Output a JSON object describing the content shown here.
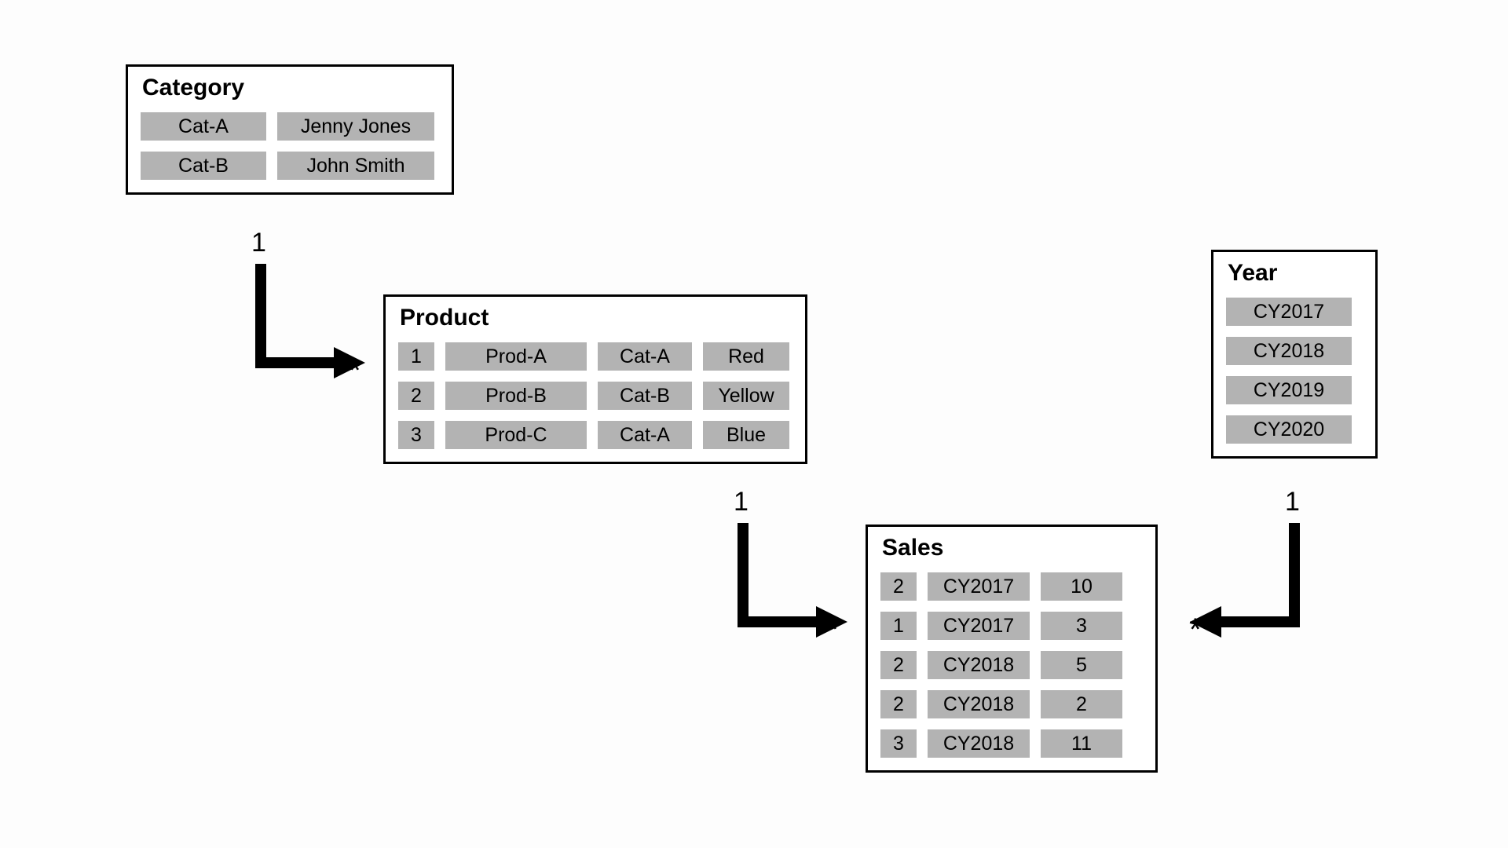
{
  "entities": {
    "category": {
      "title": "Category",
      "rows": [
        [
          "Cat-A",
          "Jenny Jones"
        ],
        [
          "Cat-B",
          "John Smith"
        ]
      ]
    },
    "product": {
      "title": "Product",
      "rows": [
        [
          "1",
          "Prod-A",
          "Cat-A",
          "Red"
        ],
        [
          "2",
          "Prod-B",
          "Cat-B",
          "Yellow"
        ],
        [
          "3",
          "Prod-C",
          "Cat-A",
          "Blue"
        ]
      ]
    },
    "year": {
      "title": "Year",
      "rows": [
        [
          "CY2017"
        ],
        [
          "CY2018"
        ],
        [
          "CY2019"
        ],
        [
          "CY2020"
        ]
      ]
    },
    "sales": {
      "title": "Sales",
      "rows": [
        [
          "2",
          "CY2017",
          "10"
        ],
        [
          "1",
          "CY2017",
          "3"
        ],
        [
          "2",
          "CY2018",
          "5"
        ],
        [
          "2",
          "CY2018",
          "2"
        ],
        [
          "3",
          "CY2018",
          "11"
        ]
      ]
    }
  },
  "labels": {
    "one_cat": "1",
    "star_cat": "*",
    "one_prod": "1",
    "star_prod": "*",
    "one_year": "1",
    "star_year": "*"
  }
}
